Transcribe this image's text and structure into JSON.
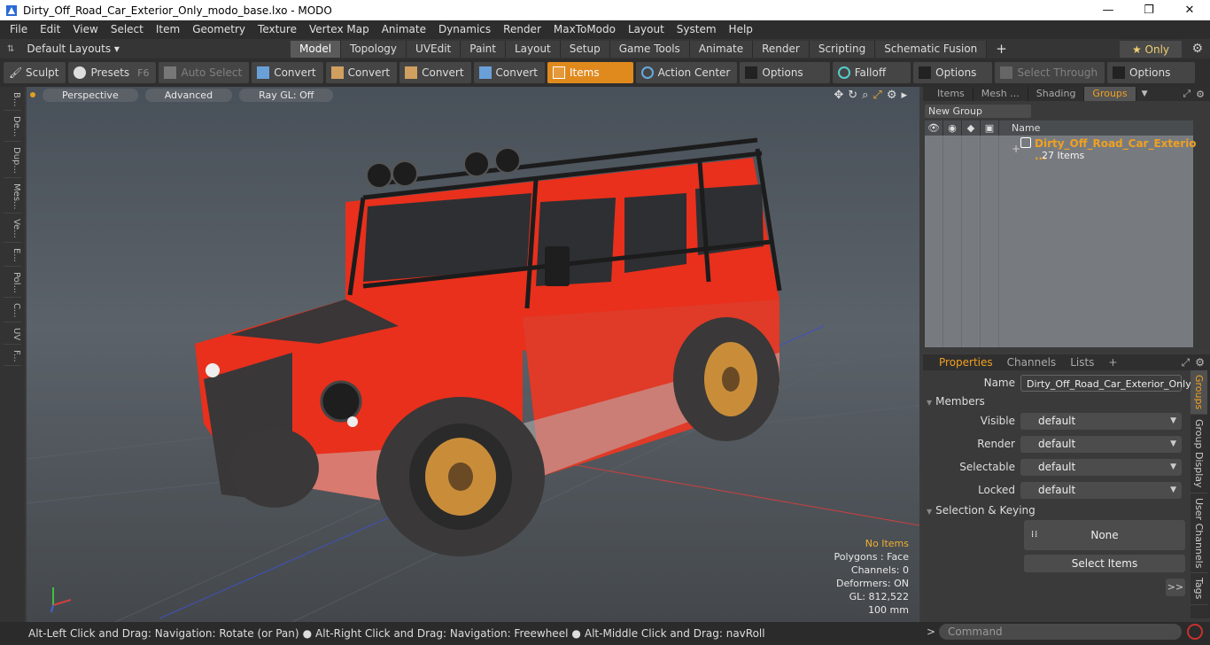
{
  "window": {
    "title": "Dirty_Off_Road_Car_Exterior_Only_modo_base.lxo - MODO",
    "minimize": "—",
    "maximize": "❐",
    "close": "✕"
  },
  "menu": [
    "File",
    "Edit",
    "View",
    "Select",
    "Item",
    "Geometry",
    "Texture",
    "Vertex Map",
    "Animate",
    "Dynamics",
    "Render",
    "MaxToModo",
    "Layout",
    "System",
    "Help"
  ],
  "layouts": {
    "selector": "Default Layouts ▾",
    "tabs": [
      "Model",
      "Topology",
      "UVEdit",
      "Paint",
      "Layout",
      "Setup",
      "Game Tools",
      "Animate",
      "Render",
      "Scripting",
      "Schematic Fusion"
    ],
    "active_tab": "Model",
    "add": "+",
    "only": "★ Only"
  },
  "toolbar": {
    "sculpt": "Sculpt",
    "presets": "Presets",
    "presets_key": "F6",
    "auto_select": "Auto Select",
    "convert1": "Convert",
    "convert2": "Convert",
    "convert3": "Convert",
    "convert4": "Convert",
    "items": "Items",
    "action_center": "Action Center",
    "options1": "Options",
    "falloff": "Falloff",
    "options2": "Options",
    "select_through": "Select Through",
    "options3": "Options"
  },
  "left_tabs": [
    "B...",
    "De...",
    "Dup...",
    "Mes...",
    "Ve...",
    "E...",
    "Pol...",
    "C...",
    "UV",
    "F..."
  ],
  "viewport": {
    "view": "Perspective",
    "shading": "Advanced",
    "raygl": "Ray GL: Off",
    "info": {
      "no_items": "No Items",
      "polygons": "Polygons : Face",
      "channels": "Channels: 0",
      "deformers": "Deformers: ON",
      "gl": "GL: 812,522",
      "scale": "100 mm"
    }
  },
  "groups_panel": {
    "tabs": [
      "Items",
      "Mesh ...",
      "Shading",
      "Groups"
    ],
    "active": "Groups",
    "new_group": "New Group",
    "col_name": "Name",
    "group_name": "Dirty_Off_Road_Car_Exterio ...",
    "group_count": "27 Items"
  },
  "properties": {
    "tabs": [
      "Properties",
      "Channels",
      "Lists"
    ],
    "add": "+",
    "name_label": "Name",
    "name_value": "Dirty_Off_Road_Car_Exterior_Only",
    "members": "Members",
    "visible_label": "Visible",
    "visible": "default",
    "render_label": "Render",
    "render": "default",
    "selectable_label": "Selectable",
    "selectable": "default",
    "locked_label": "Locked",
    "locked": "default",
    "sel_keying": "Selection & Keying",
    "none": "None",
    "select_items": "Select Items",
    "more": ">>",
    "side_tabs": [
      "Groups",
      "Group Display",
      "User Channels",
      "Tags"
    ]
  },
  "status": {
    "hint1": "Alt-Left Click and Drag: Navigation: Rotate (or Pan)",
    "hint2": "Alt-Right Click and Drag: Navigation: Freewheel",
    "hint3": "Alt-Middle Click and Drag: navRoll",
    "command_placeholder": "Command"
  }
}
